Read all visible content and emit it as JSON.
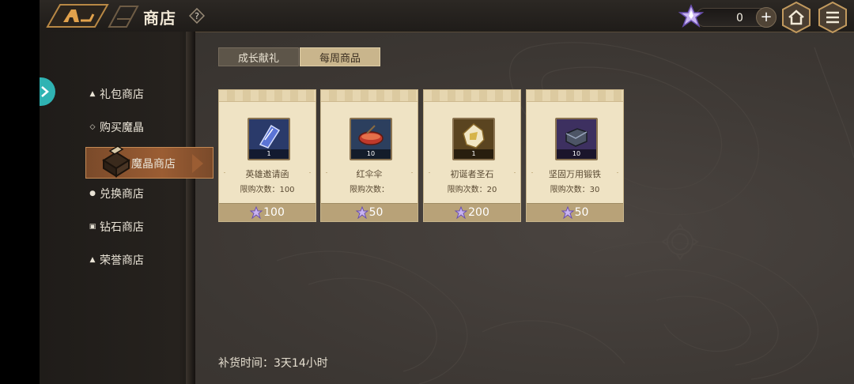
{
  "header": {
    "title": "商店"
  },
  "currency": {
    "value": "0"
  },
  "sidebar": {
    "items": [
      {
        "label": "礼包商店"
      },
      {
        "label": "购买魔晶"
      },
      {
        "label": "魔晶商店"
      },
      {
        "label": "兑换商店"
      },
      {
        "label": "钻石商店"
      },
      {
        "label": "荣誉商店"
      }
    ]
  },
  "tabs": [
    {
      "label": "成长献礼"
    },
    {
      "label": "每周商品"
    }
  ],
  "items": [
    {
      "name": "英雄邀请函",
      "count": "1",
      "limit": "限购次数：100",
      "price": "100",
      "icon_color": "#2a3a6a"
    },
    {
      "name": "红伞伞",
      "count": "10",
      "limit": "限购次数：",
      "price": "50",
      "icon_color": "#2c3f5e"
    },
    {
      "name": "初诞者圣石",
      "count": "1",
      "limit": "限购次数：20",
      "price": "200",
      "icon_color": "#5a4420"
    },
    {
      "name": "坚固万用锻铁",
      "count": "10",
      "limit": "限购次数：30",
      "price": "50",
      "icon_color": "#3d3060"
    }
  ],
  "footer": {
    "restock": "补货时间：3天14小时"
  }
}
